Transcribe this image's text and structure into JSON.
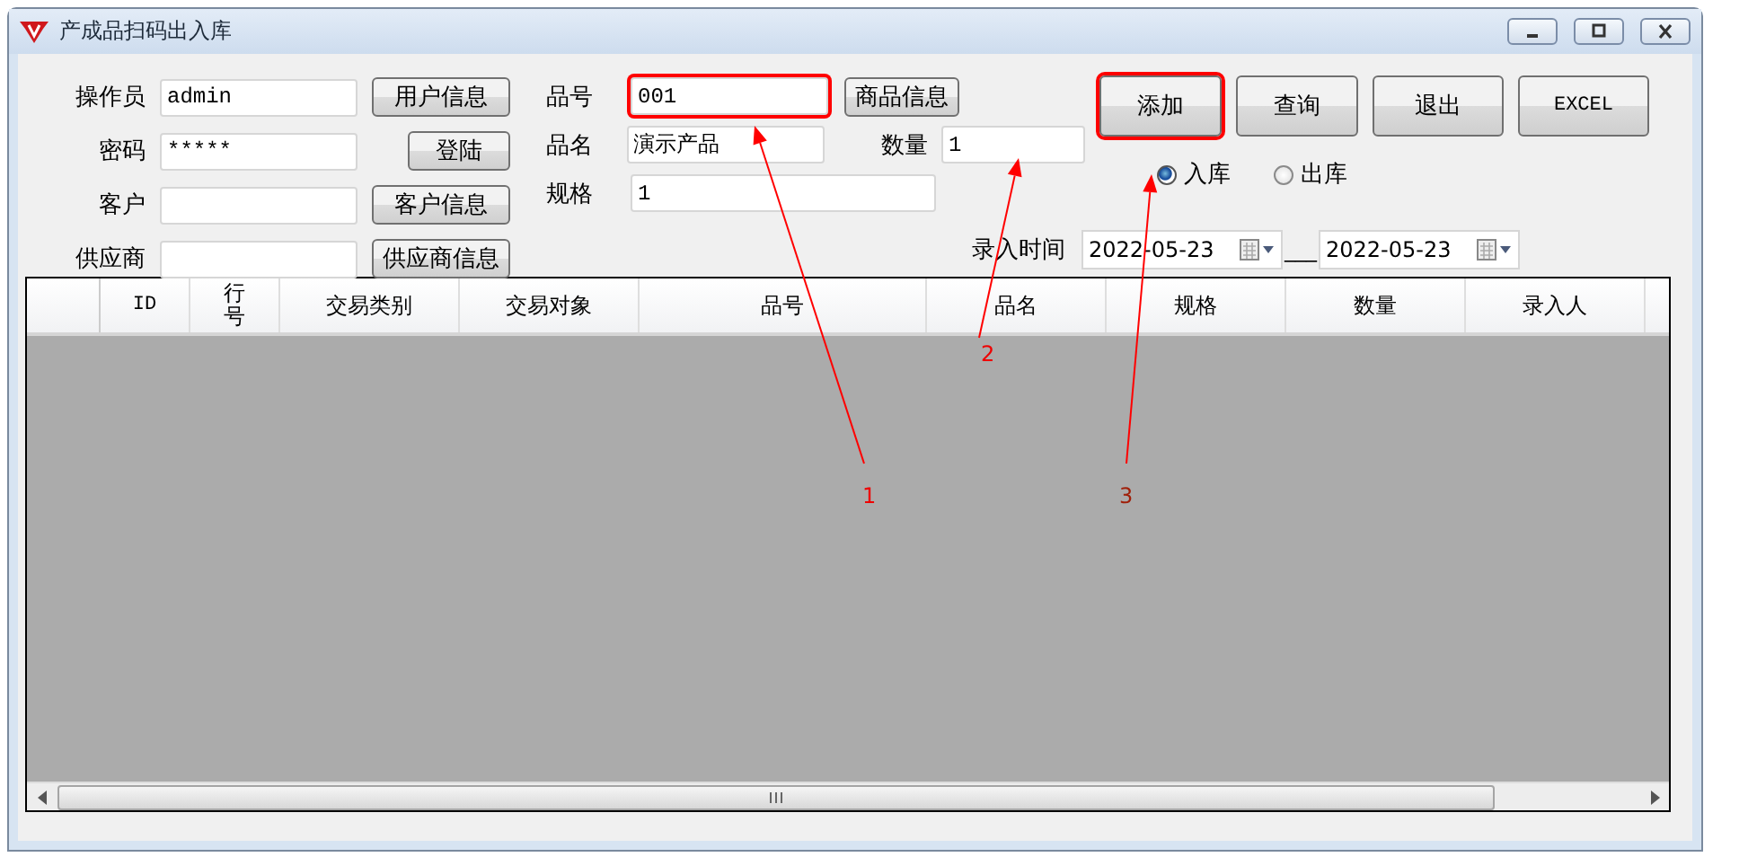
{
  "window": {
    "title": "产成品扫码出入库"
  },
  "left_fields": [
    {
      "label": "操作员",
      "value": "admin",
      "button": "用户信息"
    },
    {
      "label": "密码",
      "value": "*****",
      "button": "登陆"
    },
    {
      "label": "客户",
      "button": "客户信息"
    },
    {
      "label": "供应商",
      "button": "供应商信息"
    }
  ],
  "product": {
    "code": {
      "label": "品号",
      "value": "001",
      "highlighted": true
    },
    "code_button": "商品信息",
    "name": {
      "label": "品名",
      "value": "演示产品"
    },
    "quantity": {
      "label": "数量",
      "value": "1"
    },
    "spec": {
      "label": "规格",
      "value": "1"
    }
  },
  "actions": [
    {
      "label": "添加",
      "highlighted": true
    },
    {
      "label": "查询",
      "highlighted": false
    },
    {
      "label": "退出",
      "highlighted": false
    },
    {
      "label": "EXCEL",
      "highlighted": false
    }
  ],
  "direction": [
    {
      "label": "入库",
      "selected": true
    },
    {
      "label": "出库",
      "selected": false
    }
  ],
  "entry_time": {
    "label": "录入时间",
    "from": "2022-05-23",
    "separator": "___",
    "to": "2022-05-23"
  },
  "table": {
    "columns": [
      "ID",
      "行号",
      "交易类别",
      "交易对象",
      "品号",
      "品名",
      "规格",
      "数量",
      "录入人"
    ]
  },
  "annotations": [
    {
      "label": "1"
    },
    {
      "label": "2"
    },
    {
      "label": "3"
    }
  ]
}
